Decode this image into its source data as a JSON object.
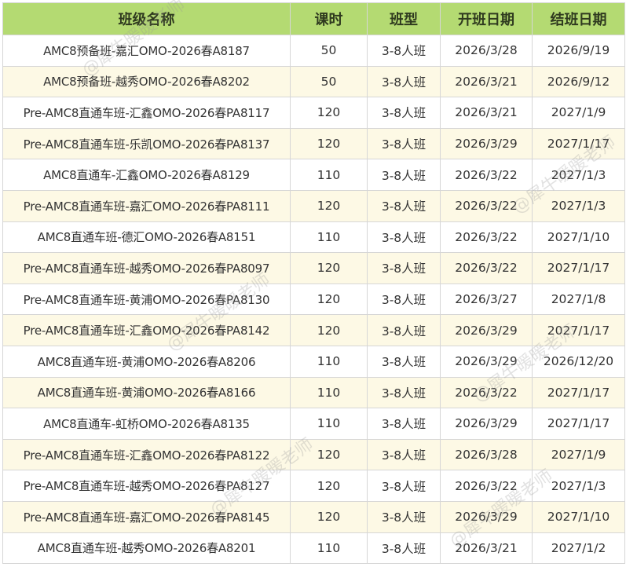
{
  "table": {
    "headers": [
      "班级名称",
      "课时",
      "班型",
      "开班日期",
      "结班日期"
    ],
    "rows": [
      [
        "AMC8预备班-嘉汇OMO-2026春A8187",
        "50",
        "3-8人班",
        "2026/3/28",
        "2026/9/19"
      ],
      [
        "AMC8预备班-越秀OMO-2026春A8202",
        "50",
        "3-8人班",
        "2026/3/21",
        "2026/9/12"
      ],
      [
        "Pre-AMC8直通车班-汇鑫OMO-2026春PA8117",
        "120",
        "3-8人班",
        "2026/3/21",
        "2027/1/9"
      ],
      [
        "Pre-AMC8直通车班-乐凯OMO-2026春PA8137",
        "120",
        "3-8人班",
        "2026/3/29",
        "2027/1/17"
      ],
      [
        "AMC8直通车-汇鑫OMO-2026春A8129",
        "110",
        "3-8人班",
        "2026/3/22",
        "2027/1/3"
      ],
      [
        "Pre-AMC8直通车班-嘉汇OMO-2026春PA8111",
        "120",
        "3-8人班",
        "2026/3/22",
        "2027/1/3"
      ],
      [
        "AMC8直通车班-德汇OMO-2026春A8151",
        "110",
        "3-8人班",
        "2026/3/22",
        "2027/1/10"
      ],
      [
        "Pre-AMC8直通车班-越秀OMO-2026春PA8097",
        "120",
        "3-8人班",
        "2026/3/22",
        "2027/1/17"
      ],
      [
        "Pre-AMC8直通车班-黄浦OMO-2026春PA8130",
        "120",
        "3-8人班",
        "2026/3/27",
        "2027/1/8"
      ],
      [
        "Pre-AMC8直通车班-汇鑫OMO-2026春PA8142",
        "120",
        "3-8人班",
        "2026/3/29",
        "2027/1/17"
      ],
      [
        "AMC8直通车班-黄浦OMO-2026春A8206",
        "110",
        "3-8人班",
        "2026/3/29",
        "2026/12/20"
      ],
      [
        "AMC8直通车班-黄浦OMO-2026春A8166",
        "110",
        "3-8人班",
        "2026/3/22",
        "2027/1/17"
      ],
      [
        "AMC8直通车-虹桥OMO-2026春A8135",
        "110",
        "3-8人班",
        "2026/3/29",
        "2027/1/17"
      ],
      [
        "Pre-AMC8直通车班-汇鑫OMO-2026春PA8122",
        "120",
        "3-8人班",
        "2026/3/28",
        "2027/1/9"
      ],
      [
        "Pre-AMC8直通车班-越秀OMO-2026春PA8127",
        "120",
        "3-8人班",
        "2026/3/22",
        "2027/1/3"
      ],
      [
        "Pre-AMC8直通车班-嘉汇OMO-2026春PA8145",
        "120",
        "3-8人班",
        "2026/3/29",
        "2027/1/10"
      ],
      [
        "AMC8直通车班-越秀OMO-2026春A8201",
        "110",
        "3-8人班",
        "2026/3/21",
        "2027/1/2"
      ]
    ]
  },
  "watermark": "@犀牛暖暖老师",
  "colors": {
    "header_bg": "#b4da72",
    "stripe_bg": "#fdf9e5",
    "border": "#d6d6d6"
  }
}
